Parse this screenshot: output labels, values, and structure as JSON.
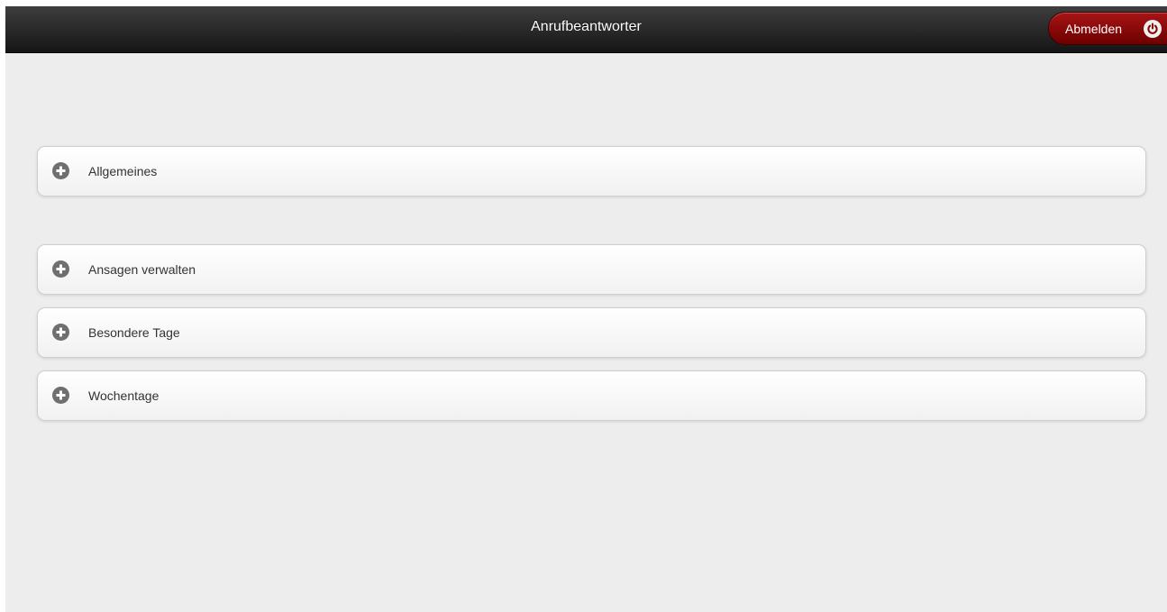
{
  "header": {
    "title": "Anrufbeantworter",
    "logout_label": "Abmelden",
    "logout_icon": "power-icon"
  },
  "sections": [
    {
      "label": "Allgemeines",
      "icon": "plus-icon"
    },
    {
      "label": "Ansagen verwalten",
      "icon": "plus-icon"
    },
    {
      "label": "Besondere Tage",
      "icon": "plus-icon"
    },
    {
      "label": "Wochentage",
      "icon": "plus-icon"
    }
  ],
  "colors": {
    "header_bg": "#1a1a1a",
    "logout_bg": "#8b0000",
    "page_bg": "#ededed",
    "icon_gray": "#6f6f6f"
  }
}
